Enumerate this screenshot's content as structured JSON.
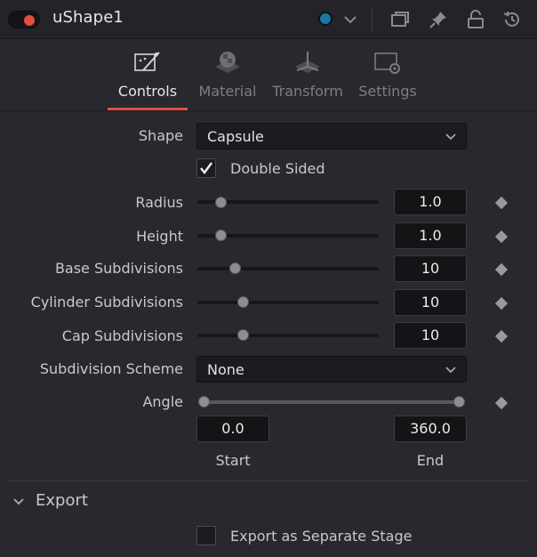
{
  "header": {
    "node_name": "uShape1",
    "toggle_color": "#e0503d",
    "node_color": "#1b78a6",
    "icons": [
      "window-icon",
      "pin-icon",
      "lock-icon",
      "reset-icon"
    ]
  },
  "tabs": [
    {
      "label": "Controls",
      "icon": "controls-icon",
      "active": true
    },
    {
      "label": "Material",
      "icon": "material-icon",
      "active": false
    },
    {
      "label": "Transform",
      "icon": "transform-icon",
      "active": false
    },
    {
      "label": "Settings",
      "icon": "settings-icon",
      "active": false
    }
  ],
  "controls": {
    "shape": {
      "label": "Shape",
      "value": "Capsule"
    },
    "double_sided": {
      "label": "Double Sided",
      "checked": true
    },
    "radius": {
      "label": "Radius",
      "value": "1.0",
      "slider_fraction": 0.13
    },
    "height": {
      "label": "Height",
      "value": "1.0",
      "slider_fraction": 0.13
    },
    "base_subdivisions": {
      "label": "Base Subdivisions",
      "value": "10",
      "slider_fraction": 0.21
    },
    "cylinder_subdivisions": {
      "label": "Cylinder Subdivisions",
      "value": "10",
      "slider_fraction": 0.25
    },
    "cap_subdivisions": {
      "label": "Cap Subdivisions",
      "value": "10",
      "slider_fraction": 0.25
    },
    "subdivision_scheme": {
      "label": "Subdivision Scheme",
      "value": "None"
    },
    "angle": {
      "label": "Angle",
      "start": "0.0",
      "end": "360.0",
      "start_label": "Start",
      "end_label": "End"
    }
  },
  "export": {
    "section_title": "Export",
    "separate_stage": {
      "label": "Export as Separate Stage",
      "checked": false
    }
  }
}
